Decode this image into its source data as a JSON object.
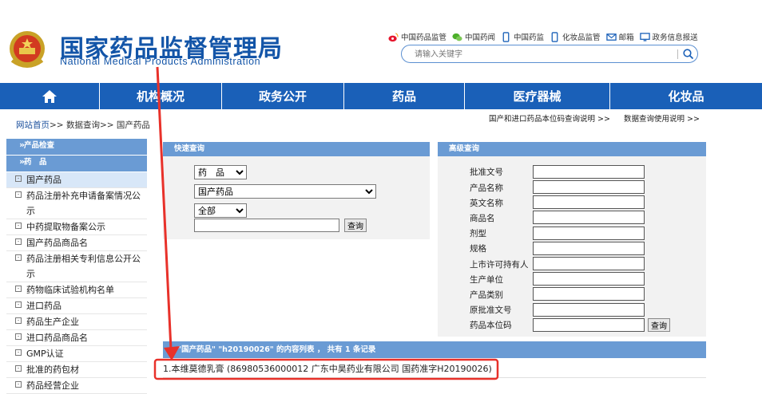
{
  "header": {
    "title_cn": "国家药品监督管理局",
    "title_en": "National Medical Products Administration",
    "top_links": [
      {
        "label": "中国药品监管",
        "icon": "weibo-icon"
      },
      {
        "label": "中国药闻",
        "icon": "wechat-icon"
      },
      {
        "label": "中国药监",
        "icon": "mobile-icon"
      },
      {
        "label": "化妆品监管",
        "icon": "mobile-icon"
      },
      {
        "label": "邮箱",
        "icon": "mail-icon"
      },
      {
        "label": "政务信息报送",
        "icon": "monitor-icon"
      }
    ],
    "search_placeholder": "请输入关键字"
  },
  "nav": {
    "home_icon": "home-icon",
    "items": [
      "机构概况",
      "政务公开",
      "药品",
      "医疗器械",
      "化妆品"
    ]
  },
  "breadcrumb": {
    "home": "网站首页",
    "sep": ">>",
    "level2": "数据查询",
    "level3": "国产药品"
  },
  "help_links": [
    "国产和进口药品本位码查询说明 >>",
    "数据查询使用说明 >>"
  ],
  "sidebar": {
    "cat1": "产品检查",
    "cat2": "药　品",
    "items": [
      {
        "label": "国产药品",
        "active": true
      },
      {
        "label": "药品注册补充申请备案情况公示"
      },
      {
        "label": "中药提取物备案公示"
      },
      {
        "label": "国产药品商品名"
      },
      {
        "label": "药品注册相关专利信息公开公示"
      },
      {
        "label": "药物临床试验机构名单"
      },
      {
        "label": "进口药品"
      },
      {
        "label": "药品生产企业"
      },
      {
        "label": "进口药品商品名"
      },
      {
        "label": "GMP认证"
      },
      {
        "label": "批准的药包材"
      },
      {
        "label": "药品经营企业"
      }
    ]
  },
  "quick_search": {
    "title": "快速查询",
    "select1": "药　品",
    "select2": "国产药品",
    "select3": "全部",
    "input_value": "",
    "button": "查询"
  },
  "advanced_search": {
    "title": "高级查询",
    "fields": [
      "批准文号",
      "产品名称",
      "英文名称",
      "商品名",
      "剂型",
      "规格",
      "上市许可持有人",
      "生产单位",
      "产品类别",
      "原批准文号",
      "药品本位码"
    ],
    "button": "查询"
  },
  "results": {
    "header": "\"国产药品\" \"h20190026\" 的内容列表 ， 共有 1 条记录",
    "rows": [
      "1.本维莫德乳膏 (86980536000012 广东中昊药业有限公司 国药准字H20190026)"
    ]
  },
  "colors": {
    "brand_blue": "#1355a8",
    "nav_blue": "#1a60b8",
    "panel_head": "#6a9bd4",
    "annotation_red": "#e8312a"
  }
}
